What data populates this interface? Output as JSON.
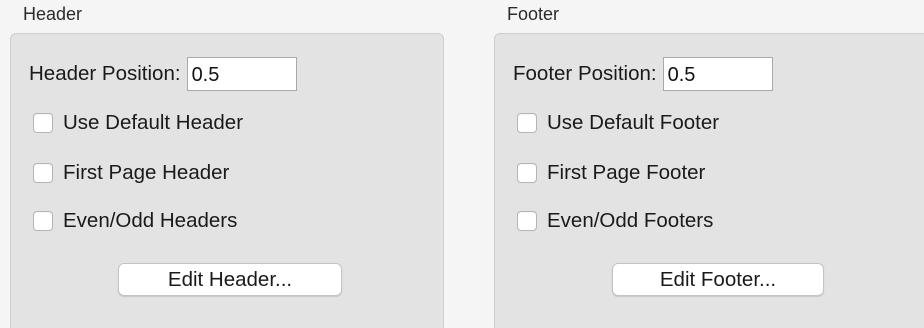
{
  "header_group": {
    "title": "Header",
    "position_label": "Header Position:",
    "position_value": "0.5",
    "checkboxes": [
      {
        "label": "Use Default Header",
        "checked": false
      },
      {
        "label": "First Page Header",
        "checked": false
      },
      {
        "label": "Even/Odd Headers",
        "checked": false
      }
    ],
    "edit_button_label": "Edit Header..."
  },
  "footer_group": {
    "title": "Footer",
    "position_label": "Footer Position:",
    "position_value": "0.5",
    "checkboxes": [
      {
        "label": "Use Default Footer",
        "checked": false
      },
      {
        "label": "First Page Footer",
        "checked": false
      },
      {
        "label": "Even/Odd Footers",
        "checked": false
      }
    ],
    "edit_button_label": "Edit Footer..."
  }
}
